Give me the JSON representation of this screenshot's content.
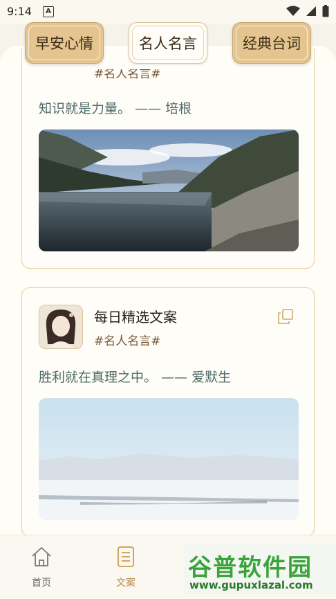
{
  "status": {
    "time": "9:14",
    "notification_glyph": "A"
  },
  "tabs": [
    {
      "label": "早安心情",
      "selected": false
    },
    {
      "label": "名人名言",
      "selected": true
    },
    {
      "label": "经典台词",
      "selected": false
    }
  ],
  "cards": [
    {
      "tag": "#名人名言#",
      "quote": "知识就是力量。 —— 培根",
      "image": "mountain-lake-photo"
    },
    {
      "title": "每日精选文案",
      "tag": "#名人名言#",
      "quote": "胜利就在真理之中。 —— 爱默生",
      "image": "snowy-plain-photo"
    }
  ],
  "bottom_nav": [
    {
      "label": "首页",
      "icon": "home-icon",
      "active": false
    },
    {
      "label": "文案",
      "icon": "document-icon",
      "active": true
    }
  ],
  "watermark": {
    "main": "谷普软件园",
    "sub": "www.gupuxlazal.com"
  },
  "colors": {
    "accent": "#e4c48f",
    "quote_text": "#4d6a6a",
    "tag_text": "#7a5a3a",
    "active_nav": "#b8893e",
    "inactive_nav": "#666666"
  }
}
